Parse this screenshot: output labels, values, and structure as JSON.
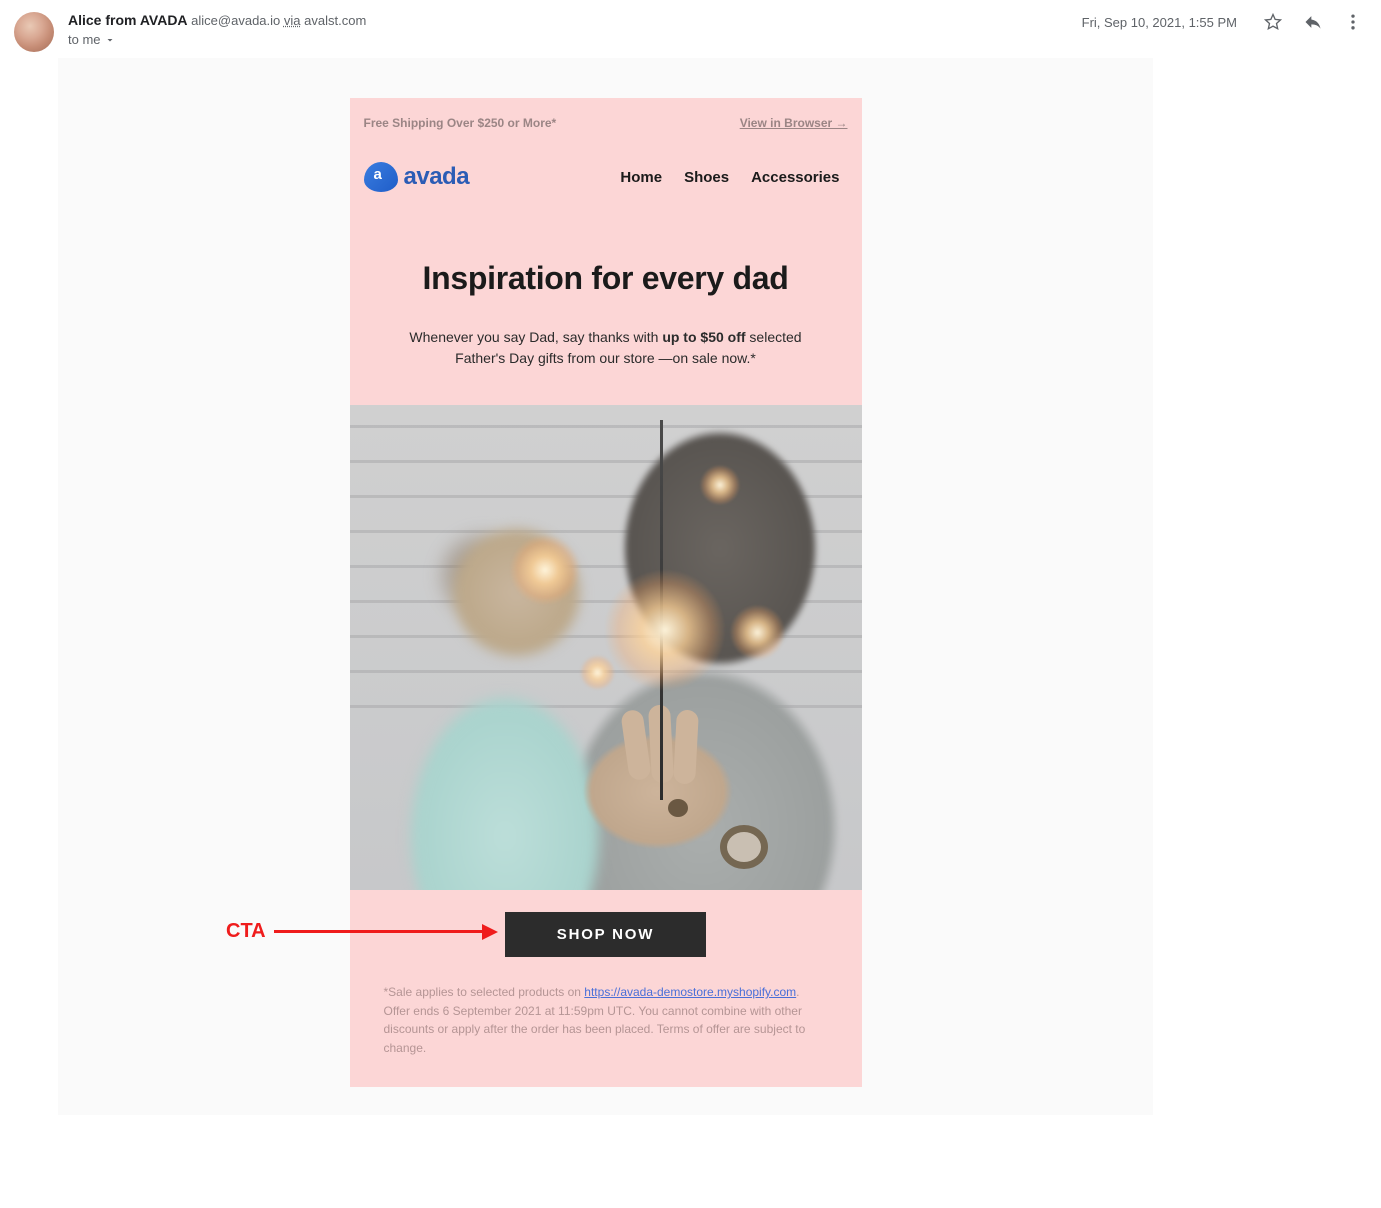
{
  "header": {
    "sender_name": "Alice from AVADA",
    "sender_email": "alice@avada.io",
    "via_label": "via",
    "via_domain": "avalst.com",
    "to_label": "to me",
    "timestamp": "Fri, Sep 10, 2021, 1:55 PM"
  },
  "email": {
    "shipping": "Free Shipping Over $250 or More*",
    "view_browser": "View in Browser →",
    "logo_text": "avada",
    "nav": {
      "home": "Home",
      "shoes": "Shoes",
      "accessories": "Accessories"
    },
    "hero_title": "Inspiration for every dad",
    "hero_sub_pre": "Whenever you say Dad, say thanks with ",
    "hero_sub_bold": "up to $50 off",
    "hero_sub_post": " selected Father's Day gifts from our store —on sale now.*",
    "cta": "SHOP NOW",
    "fine_pre": "*Sale applies to selected products on ",
    "fine_link": "https://avada-demostore.myshopify.com",
    "fine_post": ". Offer ends 6 September 2021 at 11:59pm UTC. You cannot combine with other discounts or apply after the order has been placed. Terms of offer are subject to change."
  },
  "annotation": {
    "label": "CTA"
  }
}
